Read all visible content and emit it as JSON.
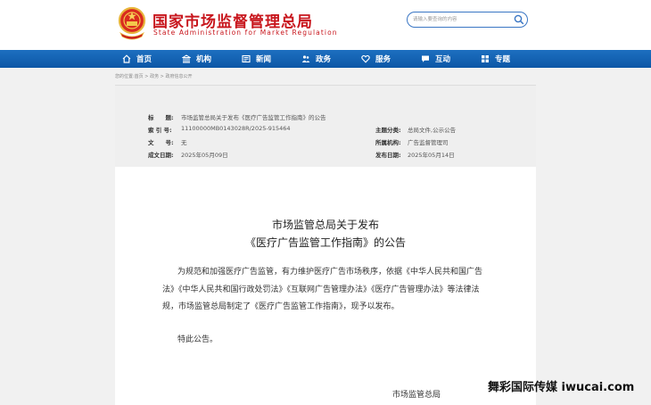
{
  "header": {
    "title": "国家市场监督管理总局",
    "subtitle": "State Administration for Market Regulation",
    "emblem_icon": "national-emblem-icon",
    "search_placeholder": "请输入要查询的内容",
    "brand_color": "#c8161d"
  },
  "nav": {
    "items": [
      {
        "label": "首页",
        "icon": "home-icon"
      },
      {
        "label": "机构",
        "icon": "building-icon"
      },
      {
        "label": "新闻",
        "icon": "newspaper-icon"
      },
      {
        "label": "政务",
        "icon": "people-icon"
      },
      {
        "label": "服务",
        "icon": "heart-icon"
      },
      {
        "label": "互动",
        "icon": "chat-icon"
      },
      {
        "label": "专题",
        "icon": "grid-icon"
      }
    ],
    "color": "#0c57a6"
  },
  "breadcrumb": [
    "您的位置:首页",
    "政务",
    "政府信息公开"
  ],
  "info": {
    "title_label": "标　　题:",
    "title_value": "市场监管总局关于发布《医疗广告监管工作指南》的公告",
    "index_label": "索 引 号:",
    "index_value": "11100000MB0143028R/2025-915464",
    "subject_label": "主题分类:",
    "subject_value": "总局文件,公示公告",
    "docno_label": "文　　号:",
    "docno_value": "无",
    "org_label": "所属机构:",
    "org_value": "广告监督管理司",
    "created_label": "成文日期:",
    "created_value": "2025年05月09日",
    "published_label": "发布日期:",
    "published_value": "2025年05月14日"
  },
  "article": {
    "title_line1": "市场监管总局关于发布",
    "title_line2": "《医疗广告监管工作指南》的公告",
    "body": "为规范和加强医疗广告监管，有力维护医疗广告市场秩序，依据《中华人民共和国广告法》《中华人民共和国行政处罚法》《互联网广告管理办法》《医疗广告管理办法》等法律法规，市场监管总局制定了《医疗广告监管工作指南》，现予以发布。",
    "closing": "特此公告。",
    "signature": "市场监管总局"
  },
  "watermark": "舞彩国际传媒 iwucai.com"
}
